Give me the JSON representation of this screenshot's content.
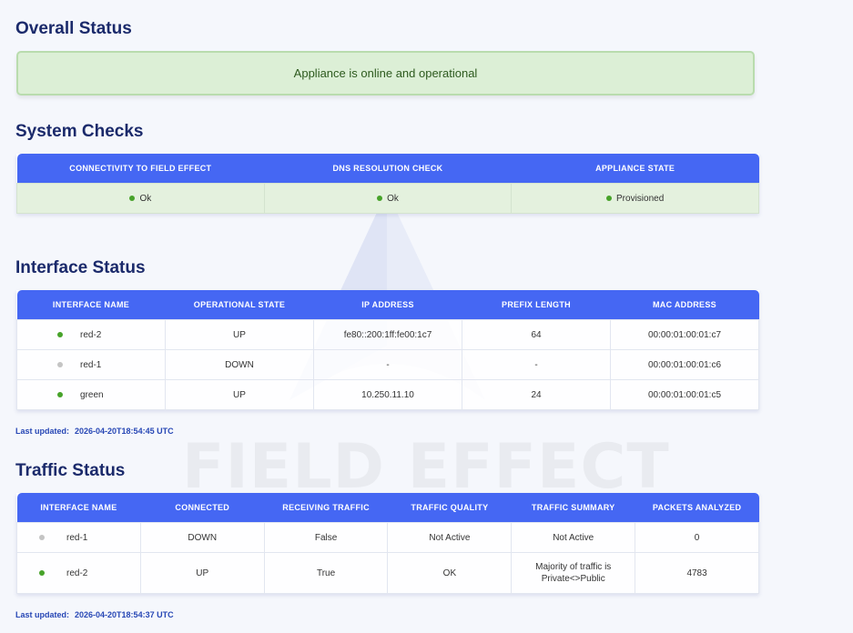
{
  "overall": {
    "title": "Overall Status",
    "message": "Appliance is online and operational"
  },
  "system_checks": {
    "title": "System Checks",
    "headers": [
      "CONNECTIVITY TO FIELD EFFECT",
      "DNS RESOLUTION CHECK",
      "APPLIANCE STATE"
    ],
    "values": [
      "Ok",
      "Ok",
      "Provisioned"
    ]
  },
  "interface": {
    "title": "Interface Status",
    "headers": [
      "INTERFACE NAME",
      "OPERATIONAL STATE",
      "IP ADDRESS",
      "PREFIX LENGTH",
      "MAC ADDRESS"
    ],
    "rows": [
      {
        "status": "green",
        "name": "red-2",
        "state": "UP",
        "ip": "fe80::200:1ff:fe00:1c7",
        "prefix": "64",
        "mac": "00:00:01:00:01:c7"
      },
      {
        "status": "grey",
        "name": "red-1",
        "state": "DOWN",
        "ip": "-",
        "prefix": "-",
        "mac": "00:00:01:00:01:c6"
      },
      {
        "status": "green",
        "name": "green",
        "state": "UP",
        "ip": "10.250.11.10",
        "prefix": "24",
        "mac": "00:00:01:00:01:c5"
      }
    ],
    "updated_label": "Last updated:",
    "updated_value": "2026-04-20T18:54:45 UTC"
  },
  "traffic": {
    "title": "Traffic Status",
    "headers": [
      "INTERFACE NAME",
      "CONNECTED",
      "RECEIVING TRAFFIC",
      "TRAFFIC QUALITY",
      "TRAFFIC SUMMARY",
      "PACKETS ANALYZED"
    ],
    "rows": [
      {
        "status": "grey",
        "name": "red-1",
        "connected": "DOWN",
        "receiving": "False",
        "quality": "Not Active",
        "summary_line1": "Not Active",
        "summary_line2": "",
        "packets": "0"
      },
      {
        "status": "green",
        "name": "red-2",
        "connected": "UP",
        "receiving": "True",
        "quality": "OK",
        "summary_line1": "Majority of traffic is",
        "summary_line2": "Private<>Public",
        "packets": "4783"
      }
    ],
    "updated_label": "Last updated:",
    "updated_value": "2026-04-20T18:54:37 UTC"
  },
  "watermark": "FIELD EFFECT",
  "colors": {
    "header_blue": "#4567f3",
    "title_navy": "#1b2a6b",
    "ok_green": "#47a32a",
    "inactive_grey": "#c4c4c4",
    "banner_bg": "#dcefd6"
  }
}
